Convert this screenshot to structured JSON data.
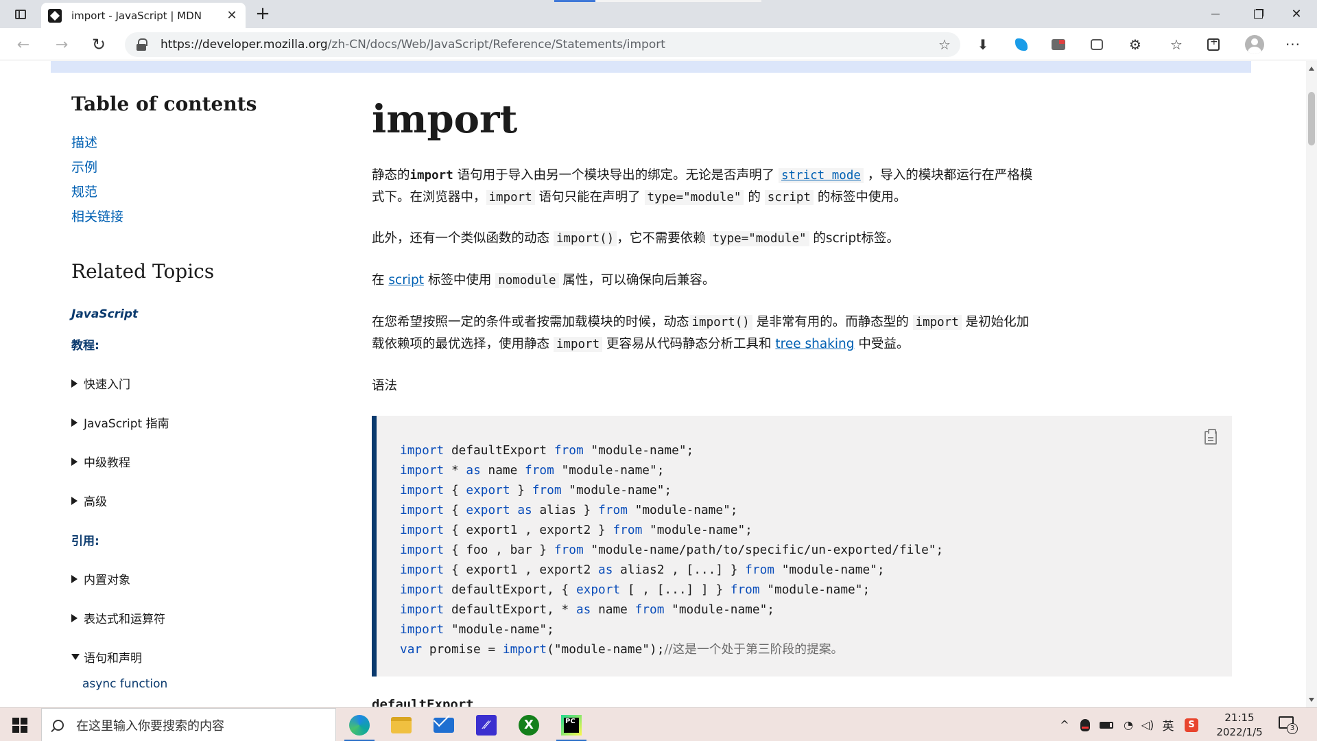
{
  "browser": {
    "tab_title": "import - JavaScript | MDN",
    "tab_close": "✕",
    "new_tab": "+",
    "url_host": "https://developer.mozilla.org",
    "url_path": "/zh-CN/docs/Web/JavaScript/Reference/Statements/import",
    "back_glyph": "←",
    "forward_glyph": "→",
    "reload_glyph": "↻",
    "fav_glyph": "☆",
    "download_glyph": "⬇",
    "puzzle_glyph": "⚙",
    "favorites_glyph": "☆",
    "more_glyph": "···",
    "close_glyph": "✕"
  },
  "sidebar": {
    "toc_title": "Table of contents",
    "toc_items": [
      "描述",
      "示例",
      "规范",
      "相关链接"
    ],
    "related_title": "Related Topics",
    "js_label": "JavaScript",
    "tutorials_label": "教程:",
    "tutorial_items": [
      "快速入门",
      "JavaScript 指南",
      "中级教程",
      "高级"
    ],
    "reference_label": "引用:",
    "reference_items": [
      "内置对象",
      "表达式和运算符",
      "语句和声明"
    ],
    "child_item": "async function"
  },
  "article": {
    "title": "import",
    "p1": {
      "t1": "静态的",
      "c1": "import",
      "t2": " 语句用于导入由另一个模块导出的绑定。无论是否声明了 ",
      "link1": "strict mode",
      "t3": " ，导入的模块都运行在严格模式下。在浏览器中，",
      "c2": "import",
      "t4": " 语句只能在声明了 ",
      "c3": "type=\"module\"",
      "t5": " 的 ",
      "c4": "script",
      "t6": " 的标签中使用。"
    },
    "p2": {
      "t1": "此外，还有一个类似函数的动态 ",
      "c1": "import()",
      "t2": "，它不需要依赖 ",
      "c2": "type=\"module\"",
      "t3": " 的script标签。"
    },
    "p3": {
      "t1": "在 ",
      "link1": "script",
      "t2": " 标签中使用 ",
      "c1": "nomodule",
      "t3": " 属性，可以确保向后兼容。"
    },
    "p4": {
      "t1": "在您希望按照一定的条件或者按需加载模块的时候，动态",
      "c1": "import()",
      "t2": " 是非常有用的。而静态型的 ",
      "c2": "import",
      "t3": " 是初始化加载依赖项的最优选择，使用静态 ",
      "c3": "import",
      "t4": " 更容易从代码静态分析工具和 ",
      "link1": "tree shaking",
      "t5": " 中受益。"
    },
    "syntax_label": "语法",
    "code_lines": [
      [
        [
          "kw",
          "import"
        ],
        [
          "t",
          " defaultExport "
        ],
        [
          "kw",
          "from"
        ],
        [
          "t",
          " \"module-name\";"
        ]
      ],
      [
        [
          "kw",
          "import"
        ],
        [
          "t",
          " * "
        ],
        [
          "kw",
          "as"
        ],
        [
          "t",
          " name "
        ],
        [
          "kw",
          "from"
        ],
        [
          "t",
          " \"module-name\";"
        ]
      ],
      [
        [
          "kw",
          "import"
        ],
        [
          "t",
          " { "
        ],
        [
          "kw",
          "export"
        ],
        [
          "t",
          " } "
        ],
        [
          "kw",
          "from"
        ],
        [
          "t",
          " \"module-name\";"
        ]
      ],
      [
        [
          "kw",
          "import"
        ],
        [
          "t",
          " { "
        ],
        [
          "kw",
          "export"
        ],
        [
          "t",
          " "
        ],
        [
          "kw",
          "as"
        ],
        [
          "t",
          " alias } "
        ],
        [
          "kw",
          "from"
        ],
        [
          "t",
          " \"module-name\";"
        ]
      ],
      [
        [
          "kw",
          "import"
        ],
        [
          "t",
          " { export1 , export2 } "
        ],
        [
          "kw",
          "from"
        ],
        [
          "t",
          " \"module-name\";"
        ]
      ],
      [
        [
          "kw",
          "import"
        ],
        [
          "t",
          " { foo , bar } "
        ],
        [
          "kw",
          "from"
        ],
        [
          "t",
          " \"module-name/path/to/specific/un-exported/file\";"
        ]
      ],
      [
        [
          "kw",
          "import"
        ],
        [
          "t",
          " { export1 , export2 "
        ],
        [
          "kw",
          "as"
        ],
        [
          "t",
          " alias2 , [...] } "
        ],
        [
          "kw",
          "from"
        ],
        [
          "t",
          " \"module-name\";"
        ]
      ],
      [
        [
          "kw",
          "import"
        ],
        [
          "t",
          " defaultExport, { "
        ],
        [
          "kw",
          "export"
        ],
        [
          "t",
          " [ , [...] ] } "
        ],
        [
          "kw",
          "from"
        ],
        [
          "t",
          " \"module-name\";"
        ]
      ],
      [
        [
          "kw",
          "import"
        ],
        [
          "t",
          " defaultExport, * "
        ],
        [
          "kw",
          "as"
        ],
        [
          "t",
          " name "
        ],
        [
          "kw",
          "from"
        ],
        [
          "t",
          " \"module-name\";"
        ]
      ],
      [
        [
          "kw",
          "import"
        ],
        [
          "t",
          " \"module-name\";"
        ]
      ],
      [
        [
          "kw",
          "var"
        ],
        [
          "t",
          " promise = "
        ],
        [
          "kw",
          "import"
        ],
        [
          "t",
          "(\"module-name\");"
        ],
        [
          "cm",
          "//这是一个处于第三阶段的提案。"
        ]
      ]
    ],
    "next_heading": "defaultExport"
  },
  "taskbar": {
    "search_placeholder": "在这里输入你要搜索的内容",
    "time": "21:15",
    "date": "2022/1/5",
    "ime": "英",
    "notification_count": "3",
    "tray_up": "^",
    "xbox_glyph": "X",
    "vs_glyph": "⁄⁄",
    "pc_glyph": "PC",
    "sogou_glyph": "S",
    "wifi_glyph": "◔",
    "volume_glyph": "◁)"
  }
}
